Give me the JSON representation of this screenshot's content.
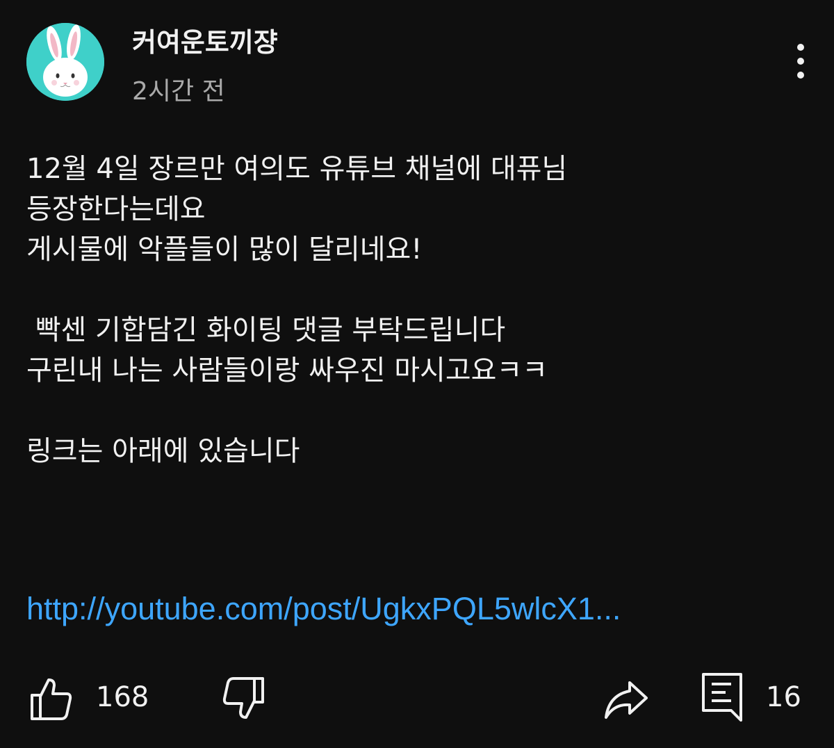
{
  "post": {
    "channel_name": "커여운토끼쟝",
    "timestamp": "2시간 전",
    "avatar_icon": "rabbit-avatar-icon",
    "more_icon": "more-vertical-icon",
    "body_lines": [
      "12월 4일 장르만 여의도 유튜브 채널에 대퓨님",
      "등장한다는데요",
      "게시물에 악플들이 많이 달리네요!",
      "",
      " 빡센 기합담긴 화이팅 댓글 부탁드립니다",
      "구린내 나는 사람들이랑 싸우진 마시고요ㅋㅋ",
      "",
      "링크는 아래에 있습니다"
    ],
    "link_text": "http://youtube.com/post/UgkxPQL5wlcX1...",
    "link_color": "#3ea6ff"
  },
  "actions": {
    "like_icon": "thumbs-up-icon",
    "like_count": "168",
    "dislike_icon": "thumbs-down-icon",
    "share_icon": "share-icon",
    "comment_icon": "comment-icon",
    "comment_count": "16"
  },
  "colors": {
    "background": "#0f0f0f",
    "text_primary": "#f1f1f1",
    "text_secondary": "#aaaaaa",
    "avatar_bg": "#3fd0c9"
  }
}
